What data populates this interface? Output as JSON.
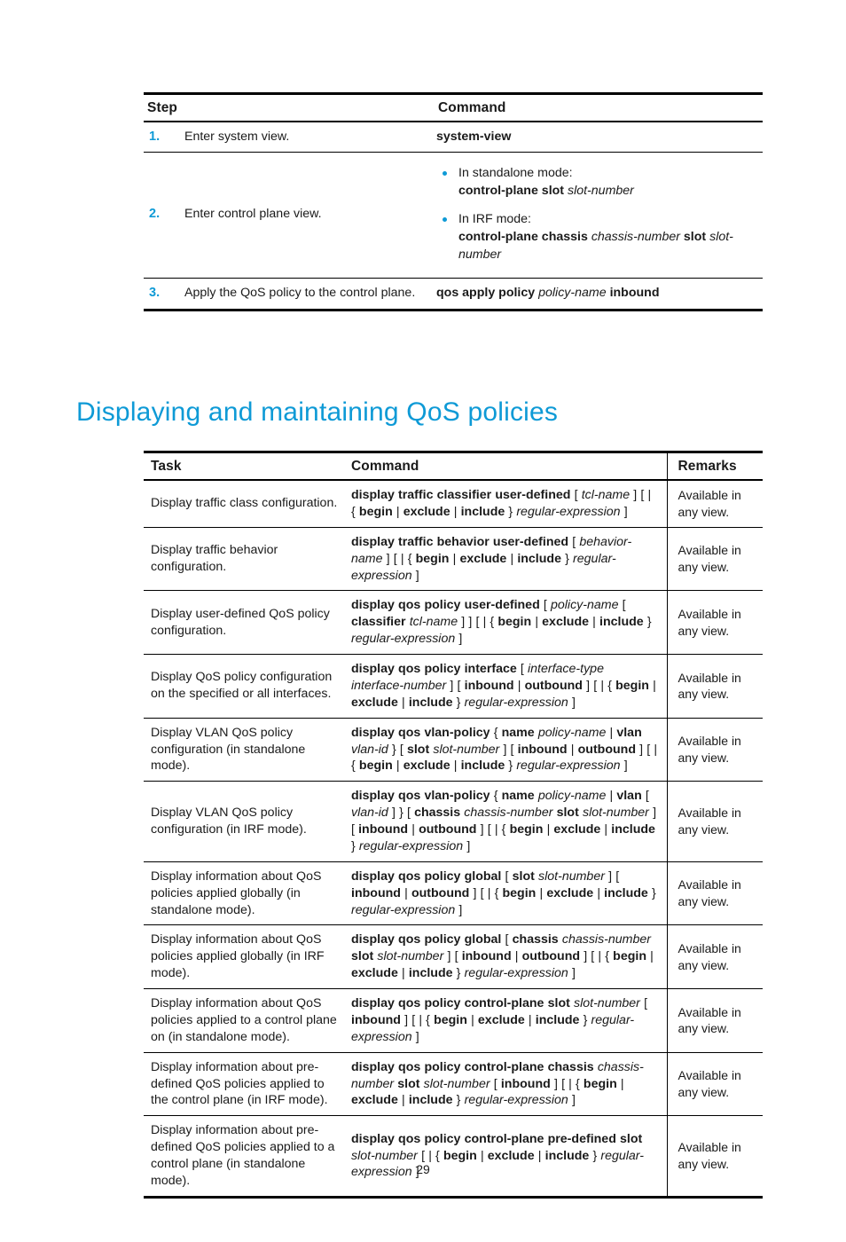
{
  "colors": {
    "accent": "#0e9ad6",
    "text": "#1a1a1a",
    "rule": "#000000"
  },
  "steps_table": {
    "headers": {
      "step": "Step",
      "command": "Command"
    },
    "rows": [
      {
        "num": "1.",
        "task": "Enter system view.",
        "command_plain": "system-view"
      },
      {
        "num": "2.",
        "task": "Enter control plane view.",
        "bullets": [
          {
            "label": "In standalone mode:",
            "cmd_bold_1": "control-plane slot",
            "cmd_italic_1": "slot-number"
          },
          {
            "label": "In IRF mode:",
            "cmd_bold_1": "control-plane chassis",
            "cmd_italic_1": "chassis-number",
            "cmd_bold_2": "slot",
            "cmd_italic_2": "slot-number"
          }
        ]
      },
      {
        "num": "3.",
        "task": "Apply the QoS policy to the control plane.",
        "cmd_bold_1": "qos apply policy",
        "cmd_italic_1": "policy-name",
        "cmd_bold_2": "inbound"
      }
    ]
  },
  "heading": "Displaying and maintaining QoS policies",
  "display_table": {
    "headers": {
      "task": "Task",
      "command": "Command",
      "remarks": "Remarks"
    },
    "rows": [
      {
        "task": "Display traffic class configuration.",
        "command": "display traffic classifier user-defined [ tcl-name ] [ | { begin | exclude | include } regular-expression ]",
        "remarks": "Available in any view."
      },
      {
        "task": "Display traffic behavior configuration.",
        "command": "display traffic behavior user-defined [ behavior-name ] [ | { begin | exclude | include } regular-expression ]",
        "remarks": "Available in any view."
      },
      {
        "task": "Display user-defined QoS policy configuration.",
        "command": "display qos policy user-defined [ policy-name [ classifier tcl-name ] ] [ | { begin | exclude | include } regular-expression ]",
        "remarks": "Available in any view."
      },
      {
        "task": "Display QoS policy configuration on the specified or all interfaces.",
        "command": "display qos policy interface [ interface-type interface-number ] [ inbound | outbound ] [ | { begin | exclude | include } regular-expression ]",
        "remarks": "Available in any view."
      },
      {
        "task": "Display VLAN QoS policy configuration (in standalone mode).",
        "command": "display qos vlan-policy { name policy-name | vlan vlan-id } [ slot slot-number ] [ inbound | outbound ] [ | { begin | exclude | include } regular-expression ]",
        "remarks": "Available in any view."
      },
      {
        "task": "Display VLAN QoS policy configuration (in IRF mode).",
        "command": "display qos vlan-policy { name policy-name | vlan [ vlan-id ] } [ chassis chassis-number slot slot-number ] [ inbound | outbound ] [ | { begin | exclude | include } regular-expression ]",
        "remarks": "Available in any view."
      },
      {
        "task": "Display information about QoS policies applied globally (in standalone mode).",
        "command": "display qos policy global [ slot slot-number ] [ inbound | outbound ] [ | { begin | exclude | include } regular-expression ]",
        "remarks": "Available in any view."
      },
      {
        "task": "Display information about QoS policies applied globally (in IRF mode).",
        "command": "display qos policy global [ chassis chassis-number slot slot-number ] [ inbound | outbound ] [ | { begin | exclude | include } regular-expression ]",
        "remarks": "Available in any view."
      },
      {
        "task": "Display information about QoS policies applied to a control plane on (in standalone mode).",
        "command": "display qos policy control-plane slot slot-number [ inbound ] [ | { begin | exclude | include } regular-expression ]",
        "remarks": "Available in any view."
      },
      {
        "task": "Display information about pre-defined QoS policies applied to the control plane (in IRF mode).",
        "command": "display qos policy control-plane chassis chassis-number slot slot-number [ inbound ] [ | { begin | exclude | include } regular-expression ]",
        "remarks": "Available in any view."
      },
      {
        "task": "Display information about pre-defined QoS policies applied to a control plane (in standalone mode).",
        "command": "display qos policy control-plane pre-defined slot slot-number [ | { begin | exclude | include } regular-expression ]",
        "remarks": "Available in any view."
      }
    ]
  },
  "footer": {
    "page_number": "29"
  }
}
